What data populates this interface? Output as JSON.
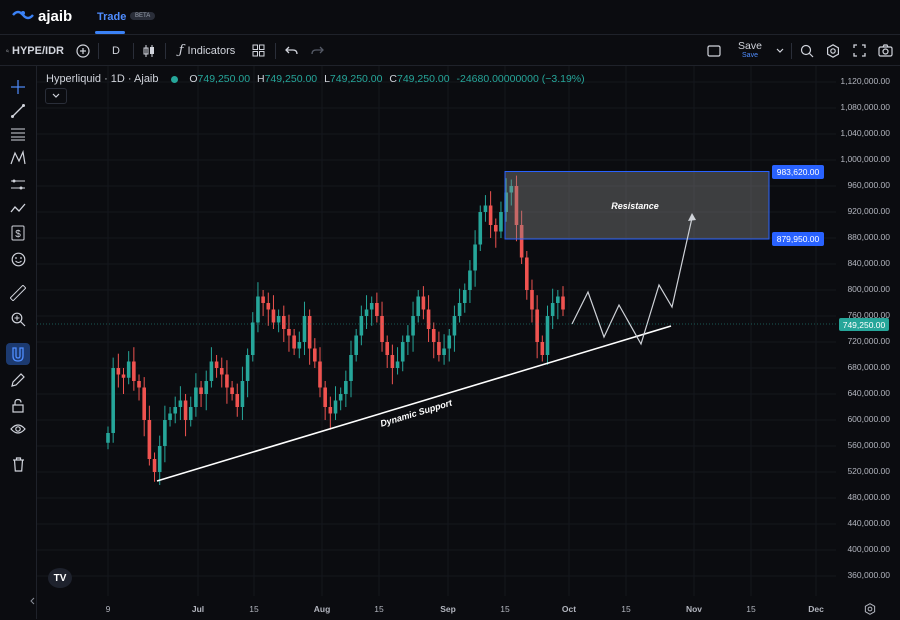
{
  "app": {
    "brand": "ajaib",
    "nav_tab": "Trade",
    "beta_badge": "BETA"
  },
  "toolbar": {
    "symbol": "HYPE/IDR",
    "interval": "D",
    "indicators_label": "Indicators",
    "save_label": "Save",
    "save_sub": "Save"
  },
  "legend": {
    "title": "Hyperliquid · 1D · Ajaib",
    "o_label": "O",
    "o_value": "749,250.00",
    "h_label": "H",
    "h_value": "749,250.00",
    "l_label": "L",
    "l_value": "749,250.00",
    "c_label": "C",
    "c_value": "749,250.00",
    "change": "-24680.00000000 (−3.19%)"
  },
  "annotations": {
    "resistance_label": "Resistance",
    "support_label": "Dynamic Support",
    "resistance_top": "983,620.00",
    "resistance_bottom": "879,950.00",
    "current_price": "749,250.00"
  },
  "colors": {
    "up": "#26a69a",
    "down": "#ef5350",
    "accent": "#2962ff",
    "background": "#0b0c10"
  },
  "chart_data": {
    "type": "candlestick",
    "y_ticks": [
      "1,120,000.00",
      "1,080,000.00",
      "1,040,000.00",
      "1,000,000.00",
      "960,000.00",
      "920,000.00",
      "880,000.00",
      "840,000.00",
      "800,000.00",
      "760,000.00",
      "720,000.00",
      "680,000.00",
      "640,000.00",
      "600,000.00",
      "560,000.00",
      "520,000.00",
      "480,000.00",
      "440,000.00",
      "400,000.00",
      "360,000.00"
    ],
    "x_ticks": [
      "9",
      "Jul",
      "15",
      "Aug",
      "15",
      "Sep",
      "15",
      "Oct",
      "15",
      "Nov",
      "15",
      "Dec"
    ],
    "ylim": [
      340000,
      1140000
    ],
    "resistance_zone": [
      879950,
      983620
    ],
    "current_price": 749250,
    "closes": [
      580000,
      680000,
      670000,
      665000,
      690000,
      660000,
      650000,
      600000,
      540000,
      520000,
      560000,
      600000,
      610000,
      620000,
      630000,
      600000,
      620000,
      650000,
      640000,
      660000,
      690000,
      680000,
      670000,
      650000,
      640000,
      620000,
      660000,
      700000,
      750000,
      790000,
      780000,
      770000,
      750000,
      760000,
      740000,
      730000,
      710000,
      720000,
      760000,
      710000,
      690000,
      650000,
      620000,
      610000,
      630000,
      640000,
      660000,
      700000,
      730000,
      760000,
      770000,
      780000,
      760000,
      720000,
      700000,
      680000,
      690000,
      720000,
      730000,
      760000,
      790000,
      770000,
      740000,
      720000,
      700000,
      710000,
      730000,
      760000,
      780000,
      800000,
      830000,
      870000,
      920000,
      930000,
      900000,
      890000,
      920000,
      950000,
      960000,
      900000,
      850000,
      800000,
      770000,
      720000,
      700000,
      760000,
      780000,
      790000,
      770000
    ]
  }
}
